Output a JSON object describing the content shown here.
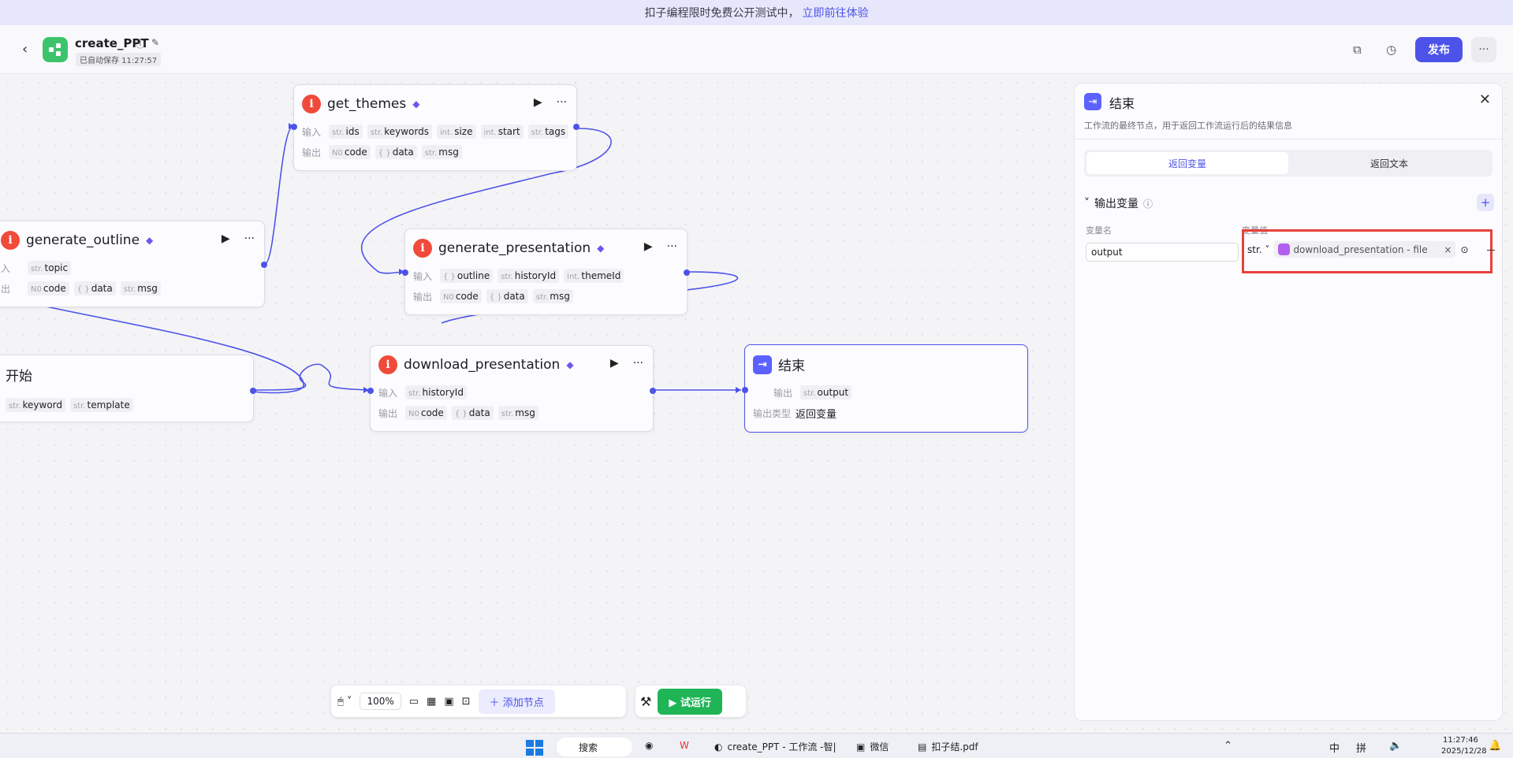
{
  "banner": {
    "text": "扣子编程限时免费公开测试中，",
    "link": "立即前往体验"
  },
  "app": {
    "name": "create_PPT",
    "saved": "已自动保存 11:27:57",
    "publish": "发布"
  },
  "nodes": {
    "get_themes": {
      "title": "get_themes",
      "in_label": "输入",
      "out_label": "输出",
      "inputs": [
        [
          "str.",
          "ids"
        ],
        [
          "str.",
          "keywords"
        ],
        [
          "int.",
          "size"
        ],
        [
          "int.",
          "start"
        ],
        [
          "str.",
          "tags"
        ]
      ],
      "outputs": [
        [
          "N0",
          "code"
        ],
        [
          "{ }",
          "data"
        ],
        [
          "str.",
          "msg"
        ]
      ]
    },
    "generate_outline": {
      "title": "generate_outline",
      "in_label": "入",
      "out_label": "出",
      "inputs": [
        [
          "str.",
          "topic"
        ]
      ],
      "outputs": [
        [
          "N0",
          "code"
        ],
        [
          "{ }",
          "data"
        ],
        [
          "str.",
          "msg"
        ]
      ]
    },
    "generate_presentation": {
      "title": "generate_presentation",
      "in_label": "输入",
      "out_label": "输出",
      "inputs": [
        [
          "{ }",
          "outline"
        ],
        [
          "str.",
          "historyId"
        ],
        [
          "int.",
          "themeId"
        ]
      ],
      "outputs": [
        [
          "N0",
          "code"
        ],
        [
          "{ }",
          "data"
        ],
        [
          "str.",
          "msg"
        ]
      ]
    },
    "start": {
      "title": "开始",
      "inputs": [
        [
          "str.",
          "keyword"
        ],
        [
          "str.",
          "template"
        ]
      ]
    },
    "download_presentation": {
      "title": "download_presentation",
      "in_label": "输入",
      "out_label": "输出",
      "inputs": [
        [
          "str.",
          "historyId"
        ]
      ],
      "outputs": [
        [
          "N0",
          "code"
        ],
        [
          "{ }",
          "data"
        ],
        [
          "str.",
          "msg"
        ]
      ]
    },
    "end": {
      "title": "结束",
      "out_label": "输出",
      "out_tag": [
        "str.",
        "output"
      ],
      "type_label": "输出类型",
      "type_value": "返回变量"
    }
  },
  "toolbar": {
    "zoom": "100%",
    "add_node": "添加节点",
    "run": "试运行"
  },
  "panel": {
    "title": "结束",
    "desc": "工作流的最终节点，用于返回工作流运行后的结果信息",
    "tabs": [
      "返回变量",
      "返回文本"
    ],
    "section": "输出变量",
    "col_name": "变量名",
    "col_value": "变量值",
    "var_name": "output",
    "var_type": "str.",
    "var_ref": "download_presentation - file"
  },
  "taskbar": {
    "search": "搜索",
    "edge_title": "create_PPT - 工作流 -智|",
    "wechat": "微信",
    "pdf": "扣子结.pdf",
    "ime1": "中",
    "ime2": "拼",
    "time": "11:27:46",
    "date": "2025/12/28"
  }
}
